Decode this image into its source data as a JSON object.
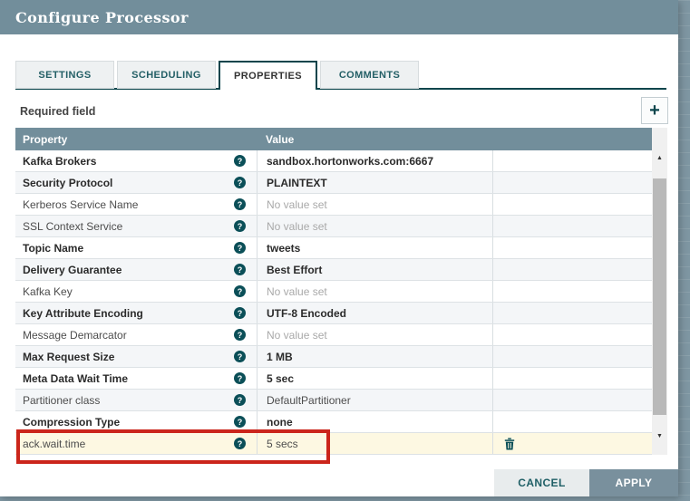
{
  "window": {
    "title": "Configure Processor"
  },
  "tabs": [
    {
      "label": "SETTINGS",
      "active": false
    },
    {
      "label": "SCHEDULING",
      "active": false
    },
    {
      "label": "PROPERTIES",
      "active": true
    },
    {
      "label": "COMMENTS",
      "active": false
    }
  ],
  "required_field_label": "Required field",
  "icons": {
    "add": "+",
    "help": "?",
    "scroll_up": "▲",
    "scroll_down": "▼",
    "delete": "trash-icon"
  },
  "table": {
    "columns": [
      "Property",
      "Value"
    ],
    "rows": [
      {
        "property": "Kafka Brokers",
        "required": true,
        "value": "sandbox.hortonworks.com:6667",
        "placeholder": false
      },
      {
        "property": "Security Protocol",
        "required": true,
        "value": "PLAINTEXT",
        "placeholder": false
      },
      {
        "property": "Kerberos Service Name",
        "required": false,
        "value": "No value set",
        "placeholder": true
      },
      {
        "property": "SSL Context Service",
        "required": false,
        "value": "No value set",
        "placeholder": true
      },
      {
        "property": "Topic Name",
        "required": true,
        "value": "tweets",
        "placeholder": false
      },
      {
        "property": "Delivery Guarantee",
        "required": true,
        "value": "Best Effort",
        "placeholder": false
      },
      {
        "property": "Kafka Key",
        "required": false,
        "value": "No value set",
        "placeholder": true
      },
      {
        "property": "Key Attribute Encoding",
        "required": true,
        "value": "UTF-8 Encoded",
        "placeholder": false
      },
      {
        "property": "Message Demarcator",
        "required": false,
        "value": "No value set",
        "placeholder": true
      },
      {
        "property": "Max Request Size",
        "required": true,
        "value": "1 MB",
        "placeholder": false
      },
      {
        "property": "Meta Data Wait Time",
        "required": true,
        "value": "5 sec",
        "placeholder": false
      },
      {
        "property": "Partitioner class",
        "required": false,
        "value": "DefaultPartitioner",
        "placeholder": false
      },
      {
        "property": "Compression Type",
        "required": true,
        "value": "none",
        "placeholder": false
      },
      {
        "property": "ack.wait.time",
        "required": false,
        "value": "5 secs",
        "placeholder": false,
        "highlighted": true,
        "deletable": true
      }
    ]
  },
  "footer": {
    "cancel_label": "CANCEL",
    "apply_label": "APPLY"
  },
  "colors": {
    "dialog_header_bg": "#728e9b",
    "table_header_bg": "#728e9b",
    "accent_teal": "#0b454c",
    "highlight_row_bg": "#fdf8e2",
    "annotation_red": "#cb251b",
    "apply_button_bg": "#79909d",
    "cancel_button_bg": "#e8eced"
  }
}
